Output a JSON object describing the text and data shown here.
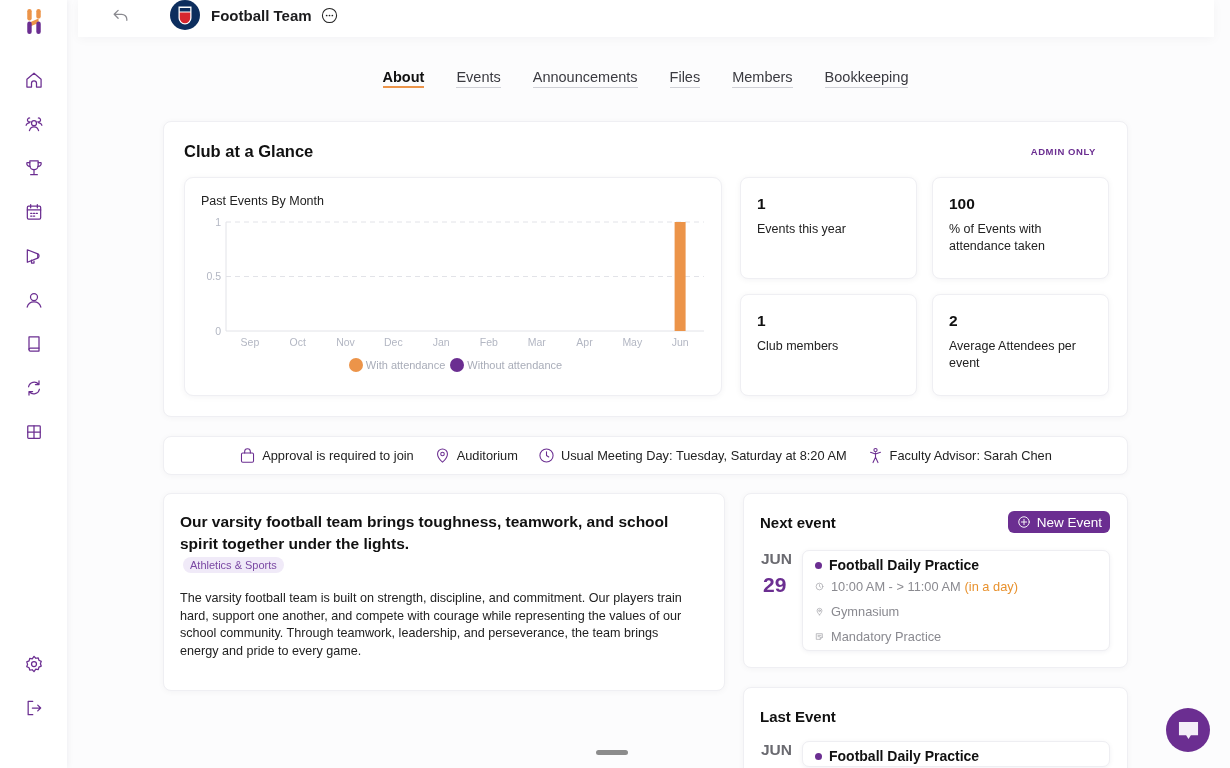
{
  "header": {
    "title": "Football Team"
  },
  "tabs": [
    {
      "label": "About",
      "selected": true
    },
    {
      "label": "Events",
      "selected": false
    },
    {
      "label": "Announcements",
      "selected": false
    },
    {
      "label": "Files",
      "selected": false
    },
    {
      "label": "Members",
      "selected": false
    },
    {
      "label": "Bookkeeping",
      "selected": false
    }
  ],
  "glance": {
    "title": "Club at a Glance",
    "badge": "ADMIN ONLY",
    "chart_data": {
      "type": "bar",
      "title": "Past Events By Month",
      "categories": [
        "Sep",
        "Oct",
        "Nov",
        "Dec",
        "Jan",
        "Feb",
        "Mar",
        "Apr",
        "May",
        "Jun"
      ],
      "series": [
        {
          "name": "With attendance",
          "color": "#ec9449",
          "values": [
            0,
            0,
            0,
            0,
            0,
            0,
            0,
            0,
            0,
            1
          ]
        },
        {
          "name": "Without attendance",
          "color": "#6b2e91",
          "values": [
            0,
            0,
            0,
            0,
            0,
            0,
            0,
            0,
            0,
            0
          ]
        }
      ],
      "ylim": [
        0,
        1
      ],
      "yticks": [
        0,
        0.5,
        1
      ],
      "stacked": true
    },
    "stats": [
      {
        "value": "1",
        "label": "Events this year"
      },
      {
        "value": "100",
        "label": "% of Events with attendance taken"
      },
      {
        "value": "1",
        "label": "Club members"
      },
      {
        "value": "2",
        "label": "Average Attendees per event"
      }
    ]
  },
  "info_bar": [
    {
      "kind": "approval",
      "text": "Approval is required to join"
    },
    {
      "kind": "location",
      "text": "Auditorium"
    },
    {
      "kind": "meeting",
      "text": "Usual Meeting Day: Tuesday, Saturday at 8:20 AM"
    },
    {
      "kind": "advisor",
      "text": "Faculty Advisor: Sarah Chen"
    }
  ],
  "about": {
    "headline": "Our varsity football team brings toughness, teamwork, and school spirit together under the lights.",
    "tag": "Athletics & Sports",
    "body": "The varsity football team is built on strength, discipline, and commitment. Our players train hard, support one another, and compete with courage while representing the values of our school community. Through teamwork, leadership, and perseverance, the team brings energy and pride to every game."
  },
  "next_event": {
    "title": "Next event",
    "button": "New Event",
    "month": "JUN",
    "day": "29",
    "name": "Football Daily Practice",
    "time": "10:00 AM - > 11:00 AM",
    "relative": "(in a day)",
    "location": "Gymnasium",
    "note": "Mandatory Practice"
  },
  "last_event": {
    "title": "Last Event",
    "month": "JUN",
    "name": "Football Daily Practice"
  }
}
